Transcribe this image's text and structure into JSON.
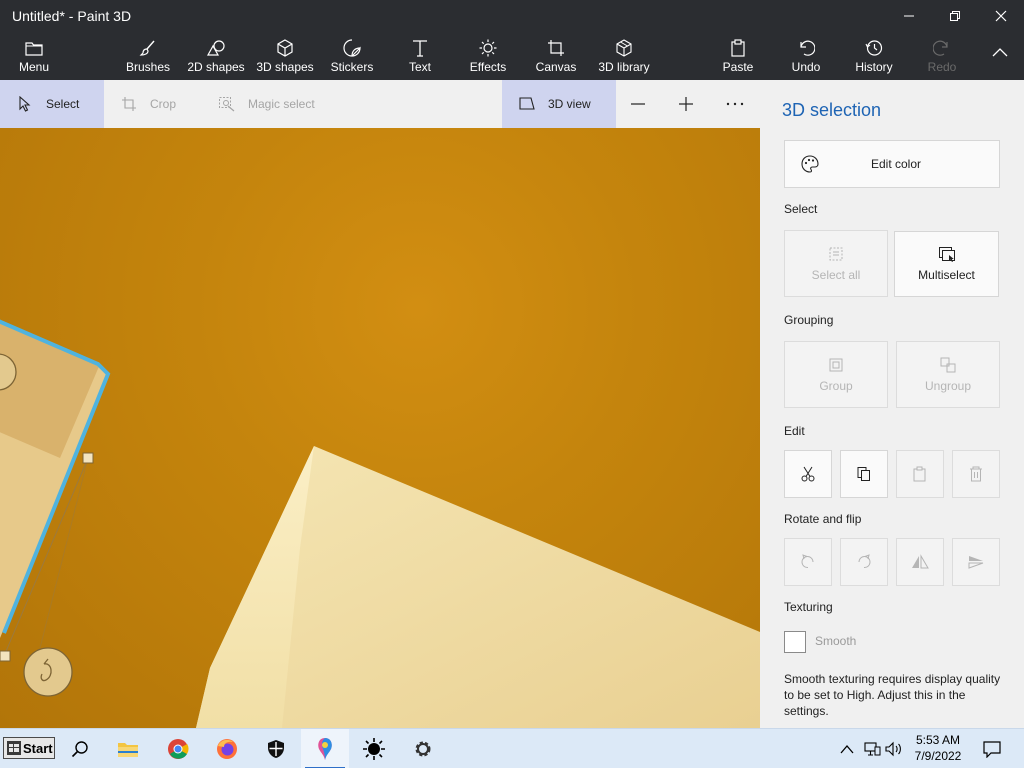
{
  "window": {
    "title": "Untitled* - Paint 3D"
  },
  "ribbon": {
    "menu": "Menu",
    "brushes": "Brushes",
    "shapes2d": "2D shapes",
    "shapes3d": "3D shapes",
    "stickers": "Stickers",
    "text": "Text",
    "effects": "Effects",
    "canvas": "Canvas",
    "library3d": "3D library",
    "paste": "Paste",
    "undo": "Undo",
    "history": "History",
    "redo": "Redo"
  },
  "toolbar": {
    "select": "Select",
    "crop": "Crop",
    "magic_select": "Magic select",
    "view3d": "3D view"
  },
  "panel": {
    "title": "3D selection",
    "edit_color": "Edit color",
    "select_label": "Select",
    "select_all": "Select all",
    "multiselect": "Multiselect",
    "grouping_label": "Grouping",
    "group": "Group",
    "ungroup": "Ungroup",
    "edit_label": "Edit",
    "rotate_label": "Rotate and flip",
    "texturing_label": "Texturing",
    "smooth": "Smooth",
    "smooth_note": "Smooth texturing requires display quality to be set to High. Adjust this in the settings."
  },
  "taskbar": {
    "start": "Start",
    "time": "5:53 AM",
    "date": "7/9/2022"
  },
  "colors": {
    "accent": "#1e64b4",
    "canvas_bg": "#c5850d",
    "selection_outline": "#4fb3df",
    "shape_light": "#f2dfa5"
  }
}
